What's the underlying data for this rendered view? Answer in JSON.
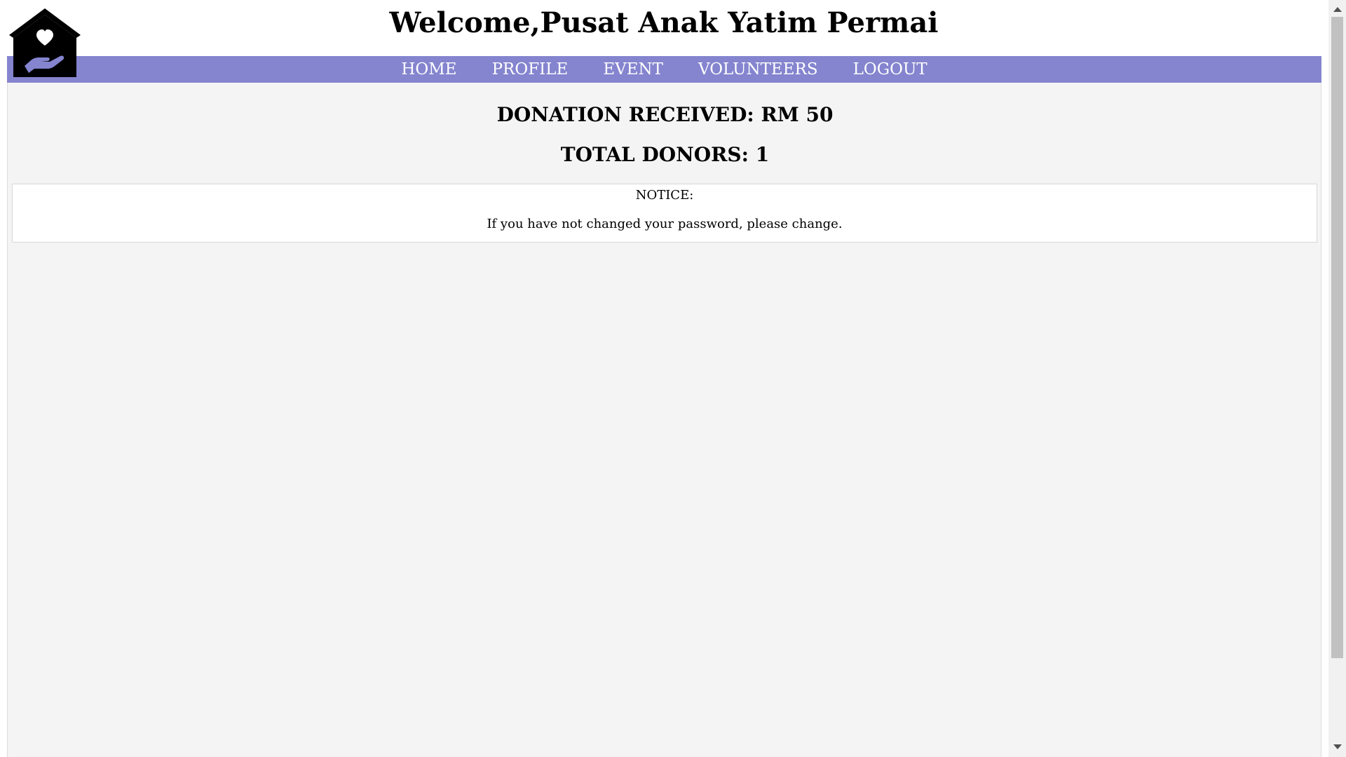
{
  "header": {
    "title": "Welcome,Pusat Anak Yatim Permai"
  },
  "logo": {
    "icon": "house-heart-hand-icon",
    "colors": {
      "house": "#000000",
      "heart": "#ffffff",
      "hand": "#8484cf"
    }
  },
  "nav": {
    "items": [
      {
        "label": "HOME"
      },
      {
        "label": "PROFILE"
      },
      {
        "label": "EVENT"
      },
      {
        "label": "VOLUNTEERS"
      },
      {
        "label": "LOGOUT"
      }
    ],
    "background": "#8484cf"
  },
  "stats": {
    "donation": "DONATION RECEIVED: RM 50",
    "donors": "TOTAL DONORS: 1"
  },
  "notice": {
    "title": "NOTICE:",
    "message": "If you have not changed your password, please change."
  }
}
